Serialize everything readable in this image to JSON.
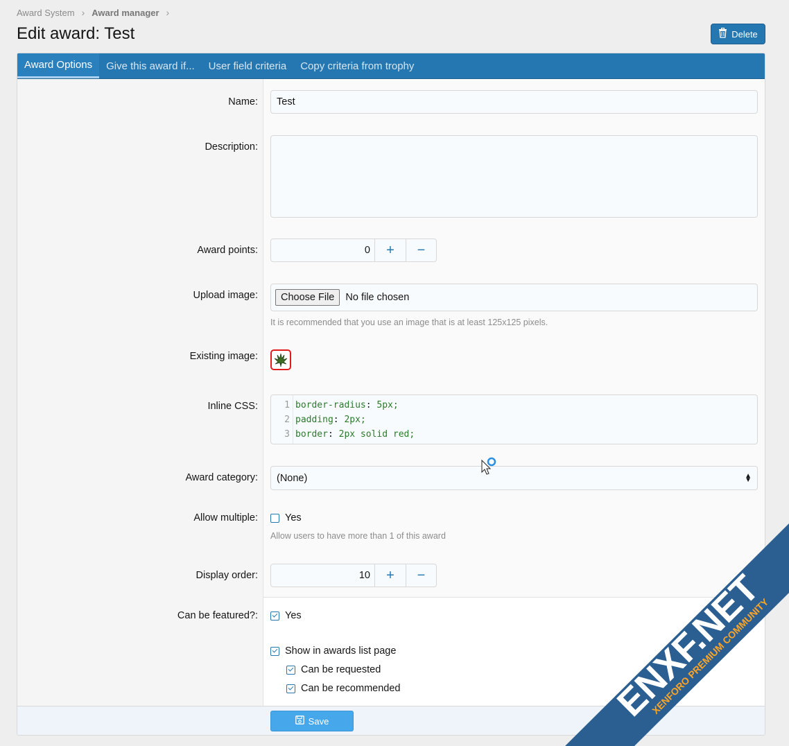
{
  "breadcrumb": {
    "item1": "Award System",
    "item2": "Award manager",
    "sep": "›"
  },
  "page": {
    "title": "Edit award: Test",
    "delete_label": "Delete"
  },
  "tabs": [
    {
      "label": "Award Options"
    },
    {
      "label": "Give this award if..."
    },
    {
      "label": "User field criteria"
    },
    {
      "label": "Copy criteria from trophy"
    }
  ],
  "form": {
    "name_label": "Name:",
    "name_value": "Test",
    "description_label": "Description:",
    "points_label": "Award points:",
    "points_value": "0",
    "upload_label": "Upload image:",
    "choose_file": "Choose File",
    "no_file": "No file chosen",
    "upload_hint": "It is recommended that you use an image that is at least 125x125 pixels.",
    "existing_label": "Existing image:",
    "css_label": "Inline CSS:",
    "css_lines": [
      {
        "num": "1",
        "prop": "border-radius",
        "val": "5px;"
      },
      {
        "num": "2",
        "prop": "padding",
        "val": "2px;"
      },
      {
        "num": "3",
        "prop": "border",
        "val": "2px solid red;"
      }
    ],
    "category_label": "Award category:",
    "category_value": "(None)",
    "multiple_label": "Allow multiple:",
    "multiple_option": "Yes",
    "multiple_hint": "Allow users to have more than 1 of this award",
    "order_label": "Display order:",
    "order_value": "10",
    "featured_label": "Can be featured?:",
    "featured_option": "Yes",
    "show_list_option": "Show in awards list page",
    "requested_option": "Can be requested",
    "recommended_option": "Can be recommended",
    "save_label": "Save"
  },
  "watermark": {
    "line1": "ENXF.NET",
    "line2": "XENFORO PREMIUM COMMUNITY"
  }
}
